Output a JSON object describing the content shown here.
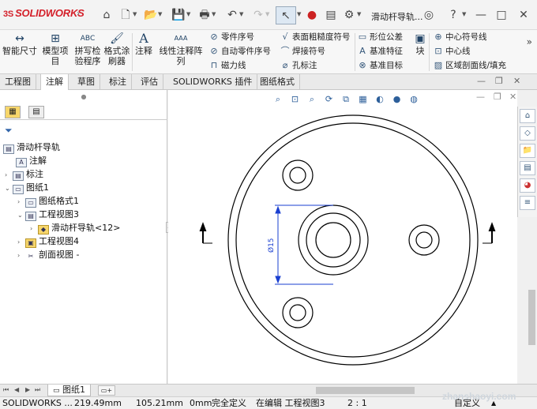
{
  "app": {
    "logo_text": "SOLIDWORKS",
    "logo_mark": "3S",
    "document_title": "滑动杆导轨..."
  },
  "quick_access": [
    {
      "name": "home-icon",
      "glyph": "⌂"
    },
    {
      "name": "new-document-icon",
      "glyph": "🗋"
    },
    {
      "name": "open-folder-icon",
      "glyph": "📂"
    },
    {
      "name": "save-icon",
      "glyph": "💾"
    },
    {
      "name": "print-icon",
      "glyph": "🖶"
    },
    {
      "name": "undo-icon",
      "glyph": "↶"
    },
    {
      "name": "redo-icon",
      "glyph": "↷"
    },
    {
      "name": "select-pointer-icon",
      "glyph": "↖"
    },
    {
      "name": "rebuild-traffic-light-icon",
      "glyph": "●"
    },
    {
      "name": "file-properties-icon",
      "glyph": "▤"
    },
    {
      "name": "options-gear-icon",
      "glyph": "⚙"
    }
  ],
  "title_icons": {
    "user": "◎",
    "help": "?",
    "minimize": "—",
    "maximize": "□",
    "close": "✕"
  },
  "command_manager": {
    "big": [
      {
        "label_1": "智能尺寸",
        "label_2": "",
        "glyph": "↔"
      },
      {
        "label_1": "模型项",
        "label_2": "目",
        "glyph": "⊞"
      },
      {
        "label_1": "拼写检",
        "label_2": "验程序",
        "glyph": "ABC"
      },
      {
        "label_1": "格式涂",
        "label_2": "刷器",
        "glyph": "🖌"
      },
      {
        "label_1": "注释",
        "label_2": "",
        "glyph": "A"
      },
      {
        "label_1": "线性注释阵列",
        "label_2": "",
        "glyph": "AAA"
      }
    ],
    "small_col1": [
      {
        "label": "零件序号",
        "glyph": "⊘"
      },
      {
        "label": "自动零件序号",
        "glyph": "⊘"
      },
      {
        "label": "磁力线",
        "glyph": "⊓"
      }
    ],
    "small_col2": [
      {
        "label": "表面粗糙度符号",
        "glyph": "√"
      },
      {
        "label": "焊接符号",
        "glyph": "⌒"
      },
      {
        "label": "孔标注",
        "glyph": "⌀"
      }
    ],
    "small_col3": [
      {
        "label": "形位公差",
        "glyph": "▭"
      },
      {
        "label": "基准特征",
        "glyph": "A"
      },
      {
        "label": "基准目标",
        "glyph": "⊗"
      }
    ],
    "block": {
      "label": "块",
      "glyph": "▣"
    },
    "small_col4": [
      {
        "label": "中心符号线",
        "glyph": "⊕"
      },
      {
        "label": "中心线",
        "glyph": "⊡"
      },
      {
        "label": "区域剖面线/填充",
        "glyph": "▨"
      }
    ],
    "more": "»"
  },
  "tabs": [
    "工程图",
    "注解",
    "草图",
    "标注",
    "评估",
    "SOLIDWORKS 插件",
    "图纸格式"
  ],
  "active_tab_index": 1,
  "feature_tree": [
    {
      "label": "滑动杆导轨",
      "toggle": "",
      "icon": "▤",
      "yellow": false
    },
    {
      "label": "注解",
      "toggle": "",
      "icon": "A",
      "yellow": false
    },
    {
      "label": "标注",
      "toggle": "›",
      "icon": "▤",
      "yellow": false
    },
    {
      "label": "图纸1",
      "toggle": "⌄",
      "icon": "▭",
      "yellow": false
    },
    {
      "label": "图纸格式1",
      "toggle": "›",
      "icon": "▭",
      "yellow": false
    },
    {
      "label": "工程视图3",
      "toggle": "⌄",
      "icon": "▤",
      "yellow": false
    },
    {
      "label": "滑动杆导轨<12>",
      "toggle": "›",
      "icon": "◆",
      "yellow": true
    },
    {
      "label": "工程视图4",
      "toggle": "›",
      "icon": "▣",
      "yellow": true
    },
    {
      "label": "剖面视图 -",
      "toggle": "›",
      "icon": "✂",
      "yellow": false
    }
  ],
  "drawing": {
    "dimension_text": "Ø15",
    "section_mark": "⊥"
  },
  "heads_up": [
    "⌕",
    "⊡",
    "⌕",
    "⟳",
    "⧉",
    "▦",
    "◐",
    "●",
    "◍"
  ],
  "task_pane": [
    "⌂",
    "◇",
    "📁",
    "▤",
    "◕",
    "≡"
  ],
  "sheet": {
    "tab_label": "图纸1",
    "nav": [
      "⏮",
      "◀",
      "▶",
      "⏭"
    ]
  },
  "status_bar": {
    "product": "SOLIDWORKS ...",
    "x": "219.49mm",
    "y": "105.21mm",
    "z": "0mm",
    "state": "完全定义",
    "editing": "在编辑 工程视图3",
    "scale": "2 : 1",
    "units": "自定义"
  },
  "watermark": "zhanshaoyi.com",
  "colors": {
    "brand_red": "#d4202a",
    "dimension_blue": "#1a3fd0",
    "icon_blue": "#35577a"
  }
}
